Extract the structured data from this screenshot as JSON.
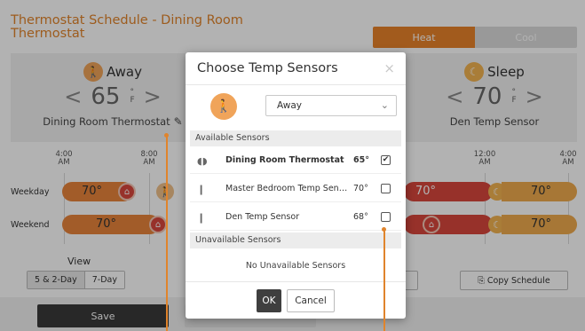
{
  "app": {
    "title": "Thermostat Schedule - Dining Room Thermostat",
    "modes": {
      "heat": "Heat",
      "cool": "Cool"
    },
    "colors": {
      "accent": "#e8832a",
      "heat_bar": "#e8853c",
      "away_bar": "#d9473d",
      "sleep": "#f3b351"
    }
  },
  "periods": {
    "away": {
      "name": "Away",
      "icon": "away-icon",
      "temp": "65",
      "unit_deg": "°",
      "unit": "F",
      "sensor": "Dining Room Thermostat"
    },
    "sleep": {
      "name": "Sleep",
      "icon": "moon-icon",
      "temp": "70",
      "unit_deg": "°",
      "unit": "F",
      "sensor": "Den Temp Sensor"
    }
  },
  "timeline": {
    "ticks": [
      {
        "time": "4:00",
        "ampm": "AM"
      },
      {
        "time": "8:00",
        "ampm": "AM"
      },
      {
        "time": "12:00",
        "ampm": "AM"
      },
      {
        "time": "4:00",
        "ampm": "AM"
      }
    ],
    "rows": [
      {
        "label": "Weekday",
        "temps": [
          "70°",
          "70°",
          "70°"
        ]
      },
      {
        "label": "Weekend",
        "temps": [
          "70°",
          "70°"
        ]
      }
    ]
  },
  "view": {
    "label": "View",
    "options": [
      "5 & 2-Day",
      "7-Day"
    ],
    "selected": "5 & 2-Day",
    "copy_schedule": "Copy Schedule"
  },
  "footer": {
    "save": "Save"
  },
  "modal": {
    "title": "Choose Temp Sensors",
    "close": "×",
    "period_select": "Away",
    "available_header": "Available Sensors",
    "sensors": [
      {
        "name": "Dining Room Thermostat",
        "temp": "65°",
        "checked": true,
        "icon": "thermostat-icon"
      },
      {
        "name": "Master Bedroom Temp Sens...",
        "temp": "70°",
        "checked": false,
        "icon": "sensor-icon"
      },
      {
        "name": "Den Temp Sensor",
        "temp": "68°",
        "checked": false,
        "icon": "sensor-icon"
      }
    ],
    "unavailable_header": "Unavailable Sensors",
    "unavailable_text": "No Unavailable Sensors",
    "ok": "OK",
    "cancel": "Cancel"
  }
}
